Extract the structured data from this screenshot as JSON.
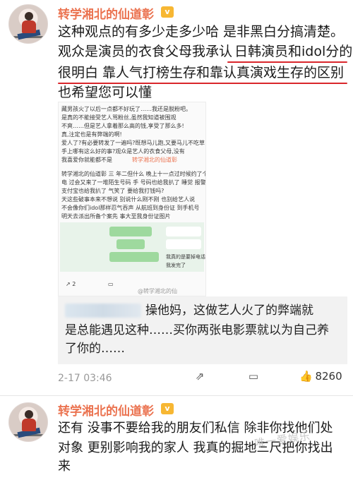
{
  "post1": {
    "username": "转学湘北的仙道彰",
    "vip_badge": "v",
    "lines": [
      "这种观点的有多少走多少哈 是非黑白分搞清楚。",
      "观众是演员的衣食父母我承认",
      "日韩演员和idol分的",
      "很明白 靠人气打榜生存和靠认真演戏生存的区别",
      "也希望您可以懂"
    ],
    "embedded": {
      "lines": [
        "藏男孩火了以后一点都不好玩了……我还是脱粉吧。",
        "是真的不能接受艺人骂粉丝,虽然我知道被围观",
        "不爽……但是艺人拿着那么高的钱,享受了那么多!",
        "真,注定也是有弊端的啊!",
        "爱人了?有必要转发了一遍吗?既想马儿跑,又要马儿不吃草",
        "手上哪有这么好的事?观众是艺人的衣食父母,没有",
        "我喜爱你就能都不是",
        "转学湘北的仙道彰",
        "转学湘北的仙道彰 三 年二但什么 晚上十一点过时候约了个",
        "电 过会又来了一堆陌生号码 手 号码也给我扒了 睡觉 报警了",
        "支付宝也给我扒了 气笑了 要给我打钱吗?",
        "天这些破事本来不想说 别说什么刚不刚 也别给艺人说",
        "不会像你们idol那样忍气吞声 从航班到身份证 到手机号",
        "明天去派出所备个案先 事大至我身份证图片",
        "我真的是要掉电话了",
        "我发完了"
      ],
      "footer_retweets": "2",
      "footer_watermark": "@转学湘北的仙"
    },
    "reply": {
      "line1": "操他妈，这做艺人火了的弊端就",
      "line2": "是总能遇见这种……买你两张电影票就以为自己养",
      "line3": "了你的……"
    },
    "time": "2-17 03:46",
    "like_count": "8260"
  },
  "post2": {
    "username": "转学湘北的仙道彰",
    "vip_badge": "v",
    "lines": [
      "还有 没事不要给我的朋友们私信 除非你找他们处",
      "对象 更别影响我的家人 我真的掘地三尺把你找出",
      "来"
    ]
  },
  "watermark": "唯一爱娱乐"
}
